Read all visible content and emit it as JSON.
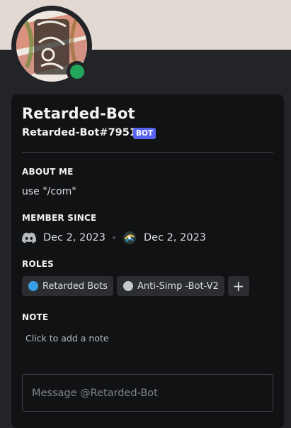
{
  "profile": {
    "display_name": "Retarded-Bot",
    "username": "Retarded-Bot#7951",
    "badge": "BOT",
    "status": "online",
    "avatar_text": "Retarded Bot"
  },
  "about": {
    "title": "ABOUT ME",
    "text": "use \"/com\""
  },
  "member_since": {
    "title": "MEMBER SINCE",
    "discord_date": "Dec 2, 2023",
    "server_date": "Dec 2, 2023"
  },
  "roles": {
    "title": "ROLES",
    "items": [
      {
        "label": "Retarded Bots",
        "color": "#3b9ee8"
      },
      {
        "label": "Anti-Simp -Bot-V2",
        "color": "#c4c9ce"
      }
    ],
    "add_label": "+"
  },
  "note": {
    "title": "NOTE",
    "placeholder": "Click to add a note"
  },
  "message": {
    "placeholder": "Message @Retarded-Bot"
  },
  "colors": {
    "banner": "#e3d9d3",
    "status_online": "#23a55a",
    "bot_badge": "#5865f2"
  }
}
